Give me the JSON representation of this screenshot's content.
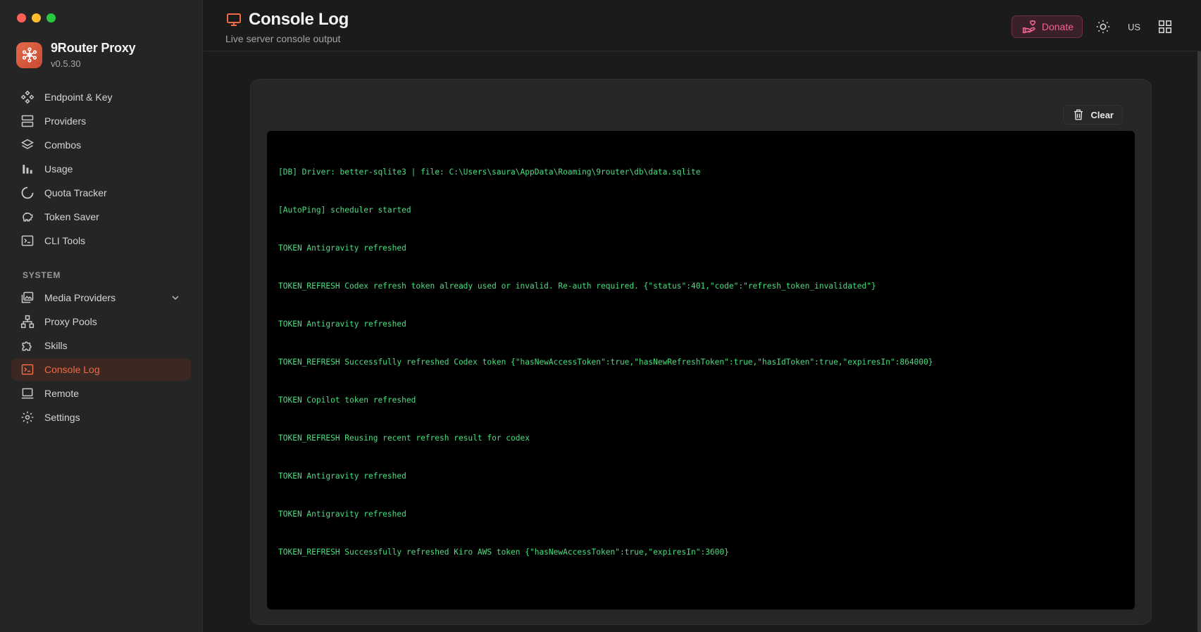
{
  "app": {
    "name": "9Router Proxy",
    "version": "v0.5.30"
  },
  "sidebar": {
    "items": [
      {
        "label": "Endpoint & Key",
        "icon": "endpoint-icon"
      },
      {
        "label": "Providers",
        "icon": "providers-icon"
      },
      {
        "label": "Combos",
        "icon": "layers-icon"
      },
      {
        "label": "Usage",
        "icon": "bar-chart-icon"
      },
      {
        "label": "Quota Tracker",
        "icon": "quota-icon"
      },
      {
        "label": "Token Saver",
        "icon": "piggy-bank-icon"
      },
      {
        "label": "CLI Tools",
        "icon": "terminal-icon"
      }
    ],
    "section_label": "SYSTEM",
    "system_items": [
      {
        "label": "Media Providers",
        "icon": "media-icon",
        "expandable": true
      },
      {
        "label": "Proxy Pools",
        "icon": "network-icon"
      },
      {
        "label": "Skills",
        "icon": "puzzle-icon"
      },
      {
        "label": "Console Log",
        "icon": "console-icon",
        "active": true
      },
      {
        "label": "Remote",
        "icon": "laptop-icon"
      },
      {
        "label": "Settings",
        "icon": "gear-icon"
      }
    ]
  },
  "header": {
    "title": "Console Log",
    "subtitle": "Live server console output",
    "donate_label": "Donate",
    "lang": "US"
  },
  "console": {
    "clear_label": "Clear",
    "lines": [
      "[DB] Driver: better-sqlite3 | file: C:\\Users\\saura\\AppData\\Roaming\\9router\\db\\data.sqlite",
      "[AutoPing] scheduler started",
      "TOKEN Antigravity refreshed",
      "TOKEN_REFRESH Codex refresh token already used or invalid. Re-auth required. {\"status\":401,\"code\":\"refresh_token_invalidated\"}",
      "TOKEN Antigravity refreshed",
      "TOKEN_REFRESH Successfully refreshed Codex token {\"hasNewAccessToken\":true,\"hasNewRefreshToken\":true,\"hasIdToken\":true,\"expiresIn\":864000}",
      "TOKEN Copilot token refreshed",
      "TOKEN_REFRESH Reusing recent refresh result for codex",
      "TOKEN Antigravity refreshed",
      "TOKEN Antigravity refreshed",
      "TOKEN_REFRESH Successfully refreshed Kiro AWS token {\"hasNewAccessToken\":true,\"expiresIn\":3600}"
    ]
  },
  "colors": {
    "accent": "#f06b45",
    "donate": "#f06292",
    "console_text": "#4ade80"
  }
}
